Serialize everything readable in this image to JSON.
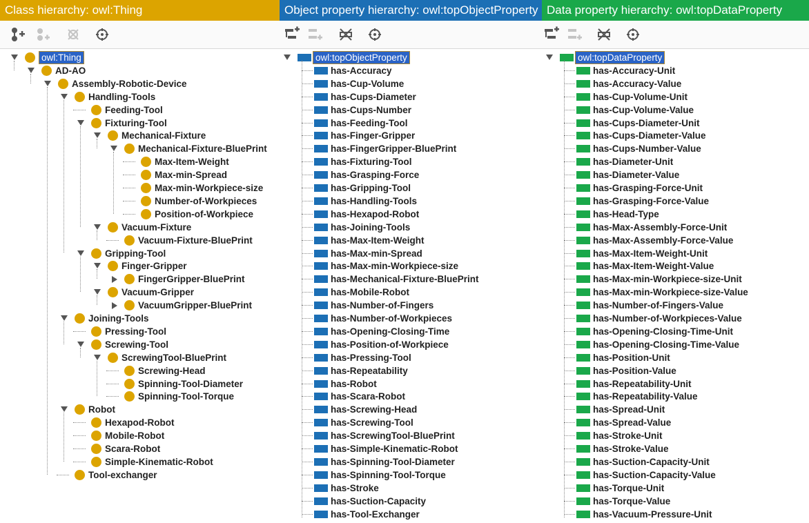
{
  "colors": {
    "class_header": "#dca400",
    "object_header": "#1c6fb5",
    "data_header": "#1aa84a",
    "class_node": "#dca400",
    "object_node": "#1c6fb5",
    "data_node": "#1aa84a",
    "selection": "#2a63c6"
  },
  "class_panel": {
    "title": "Class hierarchy: owl:Thing",
    "toolbar": [
      "add-subclass-icon",
      "add-sibling-class-icon",
      "delete-class-icon",
      "watch-icon"
    ],
    "tree": [
      {
        "label": "owl:Thing",
        "depth": 0,
        "toggle": "open",
        "selected": true
      },
      {
        "label": "AD-AO",
        "depth": 1,
        "toggle": "open"
      },
      {
        "label": "Assembly-Robotic-Device",
        "depth": 2,
        "toggle": "open"
      },
      {
        "label": "Handling-Tools",
        "depth": 3,
        "toggle": "open"
      },
      {
        "label": "Feeding-Tool",
        "depth": 4,
        "toggle": "none"
      },
      {
        "label": "Fixturing-Tool",
        "depth": 4,
        "toggle": "open"
      },
      {
        "label": "Mechanical-Fixture",
        "depth": 5,
        "toggle": "open"
      },
      {
        "label": "Mechanical-Fixture-BluePrint",
        "depth": 6,
        "toggle": "open"
      },
      {
        "label": "Max-Item-Weight",
        "depth": 7,
        "toggle": "none"
      },
      {
        "label": "Max-min-Spread",
        "depth": 7,
        "toggle": "none"
      },
      {
        "label": "Max-min-Workpiece-size",
        "depth": 7,
        "toggle": "none"
      },
      {
        "label": "Number-of-Workpieces",
        "depth": 7,
        "toggle": "none"
      },
      {
        "label": "Position-of-Workpiece",
        "depth": 7,
        "toggle": "none"
      },
      {
        "label": "Vacuum-Fixture",
        "depth": 5,
        "toggle": "open"
      },
      {
        "label": "Vacuum-Fixture-BluePrint",
        "depth": 6,
        "toggle": "none"
      },
      {
        "label": "Gripping-Tool",
        "depth": 4,
        "toggle": "open"
      },
      {
        "label": "Finger-Gripper",
        "depth": 5,
        "toggle": "open"
      },
      {
        "label": "FingerGripper-BluePrint",
        "depth": 6,
        "toggle": "closed"
      },
      {
        "label": "Vacuum-Gripper",
        "depth": 5,
        "toggle": "open"
      },
      {
        "label": "VacuumGripper-BluePrint",
        "depth": 6,
        "toggle": "closed"
      },
      {
        "label": "Joining-Tools",
        "depth": 3,
        "toggle": "open"
      },
      {
        "label": "Pressing-Tool",
        "depth": 4,
        "toggle": "none"
      },
      {
        "label": "Screwing-Tool",
        "depth": 4,
        "toggle": "open"
      },
      {
        "label": "ScrewingTool-BluePrint",
        "depth": 5,
        "toggle": "open"
      },
      {
        "label": "Screwing-Head",
        "depth": 6,
        "toggle": "none"
      },
      {
        "label": "Spinning-Tool-Diameter",
        "depth": 6,
        "toggle": "none"
      },
      {
        "label": "Spinning-Tool-Torque",
        "depth": 6,
        "toggle": "none"
      },
      {
        "label": "Robot",
        "depth": 3,
        "toggle": "open"
      },
      {
        "label": "Hexapod-Robot",
        "depth": 4,
        "toggle": "none"
      },
      {
        "label": "Mobile-Robot",
        "depth": 4,
        "toggle": "none"
      },
      {
        "label": "Scara-Robot",
        "depth": 4,
        "toggle": "none"
      },
      {
        "label": "Simple-Kinematic-Robot",
        "depth": 4,
        "toggle": "none"
      },
      {
        "label": "Tool-exchanger",
        "depth": 3,
        "toggle": "none"
      }
    ]
  },
  "object_panel": {
    "title": "Object property hierarchy: owl:topObjectProperty",
    "toolbar": [
      "add-subproperty-icon",
      "add-sibling-property-icon",
      "delete-property-icon",
      "watch-icon"
    ],
    "root": "owl:topObjectProperty",
    "items": [
      "has-Accuracy",
      "has-Cup-Volume",
      "has-Cups-Diameter",
      "has-Cups-Number",
      "has-Feeding-Tool",
      "has-Finger-Gripper",
      "has-FingerGripper-BluePrint",
      "has-Fixturing-Tool",
      "has-Grasping-Force",
      "has-Gripping-Tool",
      "has-Handling-Tools",
      "has-Hexapod-Robot",
      "has-Joining-Tools",
      "has-Max-Item-Weight",
      "has-Max-min-Spread",
      "has-Max-min-Workpiece-size",
      "has-Mechanical-Fixture-BluePrint",
      "has-Mobile-Robot",
      "has-Number-of-Fingers",
      "has-Number-of-Workpieces",
      "has-Opening-Closing-Time",
      "has-Position-of-Workpiece",
      "has-Pressing-Tool",
      "has-Repeatability",
      "has-Robot",
      "has-Scara-Robot",
      "has-Screwing-Head",
      "has-Screwing-Tool",
      "has-ScrewingTool-BluePrint",
      "has-Simple-Kinematic-Robot",
      "has-Spinning-Tool-Diameter",
      "has-Spinning-Tool-Torque",
      "has-Stroke",
      "has-Suction-Capacity",
      "has-Tool-Exchanger"
    ]
  },
  "data_panel": {
    "title": "Data property hierarchy: owl:topDataProperty",
    "toolbar": [
      "add-subproperty-icon",
      "add-sibling-property-icon",
      "delete-property-icon",
      "watch-icon"
    ],
    "root": "owl:topDataProperty",
    "items": [
      "has-Accuracy-Unit",
      "has-Accuracy-Value",
      "has-Cup-Volume-Unit",
      "has-Cup-Volume-Value",
      "has-Cups-Diameter-Unit",
      "has-Cups-Diameter-Value",
      "has-Cups-Number-Value",
      "has-Diameter-Unit",
      "has-Diameter-Value",
      "has-Grasping-Force-Unit",
      "has-Grasping-Force-Value",
      "has-Head-Type",
      "has-Max-Assembly-Force-Unit",
      "has-Max-Assembly-Force-Value",
      "has-Max-Item-Weight-Unit",
      "has-Max-Item-Weight-Value",
      "has-Max-min-Workpiece-size-Unit",
      "has-Max-min-Workpiece-size-Value",
      "has-Number-of-Fingers-Value",
      "has-Number-of-Workpieces-Value",
      "has-Opening-Closing-Time-Unit",
      "has-Opening-Closing-Time-Value",
      "has-Position-Unit",
      "has-Position-Value",
      "has-Repeatability-Unit",
      "has-Repeatability-Value",
      "has-Spread-Unit",
      "has-Spread-Value",
      "has-Stroke-Unit",
      "has-Stroke-Value",
      "has-Suction-Capacity-Unit",
      "has-Suction-Capacity-Value",
      "has-Torque-Unit",
      "has-Torque-Value",
      "has-Vacuum-Pressure-Unit"
    ]
  }
}
